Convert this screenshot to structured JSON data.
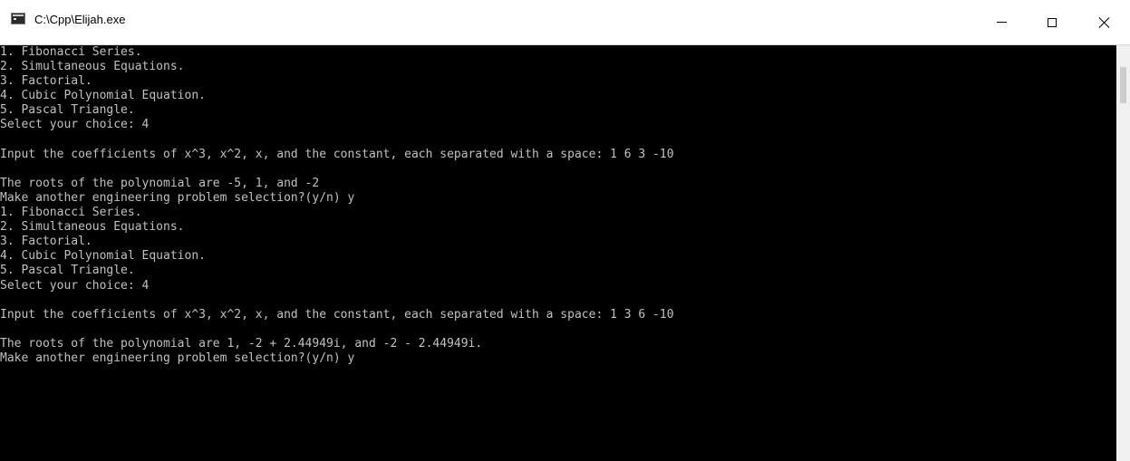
{
  "window": {
    "title": "C:\\Cpp\\Elijah.exe",
    "icons": {
      "app": "console-app-icon",
      "minimize": "minimize-icon",
      "maximize": "maximize-icon",
      "close": "close-icon"
    }
  },
  "console": {
    "lines": [
      "1. Fibonacci Series.",
      "2. Simultaneous Equations.",
      "3. Factorial.",
      "4. Cubic Polynomial Equation.",
      "5. Pascal Triangle.",
      "Select your choice: 4",
      "",
      "Input the coefficients of x^3, x^2, x, and the constant, each separated with a space: 1 6 3 -10",
      "",
      "The roots of the polynomial are -5, 1, and -2",
      "Make another engineering problem selection?(y/n) y",
      "1. Fibonacci Series.",
      "2. Simultaneous Equations.",
      "3. Factorial.",
      "4. Cubic Polynomial Equation.",
      "5. Pascal Triangle.",
      "Select your choice: 4",
      "",
      "Input the coefficients of x^3, x^2, x, and the constant, each separated with a space: 1 3 6 -10",
      "",
      "The roots of the polynomial are 1, -2 + 2.44949i, and -2 - 2.44949i.",
      "Make another engineering problem selection?(y/n) y"
    ]
  },
  "colors": {
    "console_bg": "#000000",
    "console_text": "#c0c0c0",
    "titlebar_bg": "#ffffff"
  }
}
